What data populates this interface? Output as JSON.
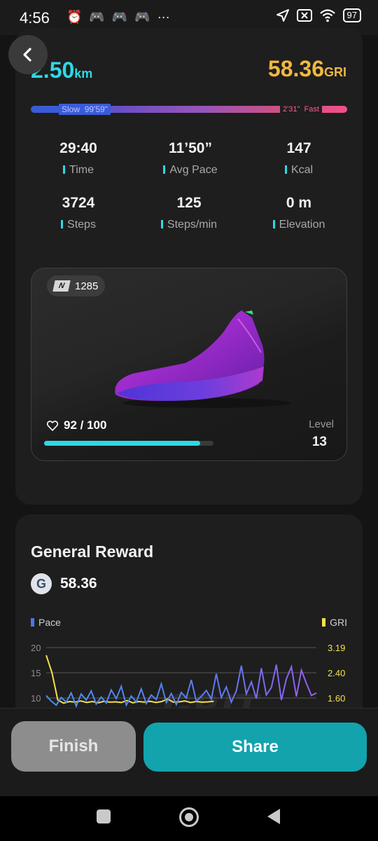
{
  "status_bar": {
    "time": "4:56",
    "left_icons": [
      "alarm-icon",
      "game-controller-icon",
      "game-controller-icon",
      "game-controller-icon",
      "more-dots-icon"
    ],
    "more": "···",
    "right_icons": [
      "location-icon",
      "no-sim-icon",
      "wifi-icon",
      "battery-icon"
    ],
    "battery": "97"
  },
  "summary": {
    "distance_value": "2.50",
    "distance_unit": "km",
    "gri_value": "58.36",
    "gri_unit": "GRI",
    "pace_slow_label": "Slow",
    "pace_slow_value": "99'59\"",
    "pace_fast_value": "2'31\"",
    "pace_fast_label": "Fast"
  },
  "stats": [
    {
      "value": "29:40",
      "label": "Time"
    },
    {
      "value": "11’50”",
      "label": "Avg Pace"
    },
    {
      "value": "147",
      "label": "Kcal"
    },
    {
      "value": "3724",
      "label": "Steps"
    },
    {
      "value": "125",
      "label": "Steps/min"
    },
    {
      "value": "0 m",
      "label": "Elevation"
    }
  ],
  "shoe": {
    "badge_logo": "N",
    "badge_id": "1285",
    "durability_text": "92 / 100",
    "durability_fraction": 0.92,
    "level_label": "Level",
    "level_value": "13"
  },
  "reward": {
    "title": "General Reward",
    "coin_letter": "G",
    "amount": "58.36"
  },
  "chart_data": {
    "type": "line",
    "legend": [
      "Pace",
      "GRI"
    ],
    "y_left_ticks": [
      "20",
      "15",
      "10"
    ],
    "y_right_ticks": [
      "3.19",
      "2.40",
      "1.60"
    ],
    "ylim_left": [
      0,
      20
    ],
    "ylim_right": [
      0,
      3.19
    ],
    "watermark": "GRIT",
    "series": [
      {
        "name": "Pace",
        "values": [
          10.5,
          9.4,
          8.6,
          10.1,
          9.2,
          11.0,
          8.4,
          10.8,
          9.6,
          11.4,
          8.8,
          10.2,
          9.0,
          11.6,
          9.9,
          12.3,
          8.6,
          10.4,
          9.2,
          11.8,
          8.9,
          10.6,
          9.7,
          12.8,
          9.1,
          10.9,
          8.7,
          11.1,
          10.0,
          13.6,
          9.4,
          10.3,
          11.5,
          9.8,
          14.8,
          10.1,
          12.2,
          9.2,
          11.4,
          16.4,
          10.8,
          13.2,
          9.9,
          15.9,
          10.6,
          12.1,
          16.6,
          9.6,
          13.8,
          16.2,
          10.3,
          15.5,
          12.9,
          10.5,
          11.0
        ]
      },
      {
        "name": "GRI",
        "values": [
          2.95,
          2.4,
          1.55,
          1.45,
          1.5,
          1.48,
          1.52,
          1.47,
          1.5,
          1.46,
          1.51,
          1.48,
          1.49,
          1.47,
          1.53,
          1.46,
          1.5,
          1.48,
          1.51,
          1.47,
          1.5,
          1.58,
          1.48,
          1.49,
          1.52,
          1.47,
          1.5,
          1.48,
          1.49,
          1.51
        ]
      }
    ]
  },
  "actions": {
    "finish": "Finish",
    "share": "Share"
  }
}
